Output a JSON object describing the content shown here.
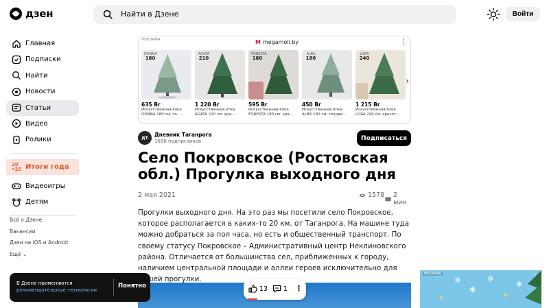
{
  "header": {
    "logo_text": "дзен",
    "search_placeholder": "Найти в Дзене",
    "login_label": "Войти"
  },
  "sidebar": {
    "items": [
      {
        "label": "Главная",
        "icon": "home-icon"
      },
      {
        "label": "Подписки",
        "icon": "subscriptions-icon"
      },
      {
        "label": "Найти",
        "icon": "search-icon"
      },
      {
        "label": "Новости",
        "icon": "news-icon"
      },
      {
        "label": "Статьи",
        "icon": "articles-icon",
        "active": true
      },
      {
        "label": "Видео",
        "icon": "video-icon"
      },
      {
        "label": "Ролики",
        "icon": "shorts-icon"
      }
    ],
    "itogi": {
      "badge_top": "20",
      "badge_bottom": "•25",
      "label": "Итоги года"
    },
    "items2": [
      {
        "label": "Видеоигры",
        "icon": "gamepad-icon"
      },
      {
        "label": "Детям",
        "icon": "kids-icon"
      }
    ],
    "footer": [
      "Всё о Дзене",
      "Вакансии",
      "Дзен на iOS и Android",
      "Ещё"
    ]
  },
  "ad": {
    "label": "РЕКЛАМА",
    "brand": "megamoll.by",
    "brand_mark": "M",
    "items": [
      {
        "tag_name": "DONNA",
        "tag_size": "180",
        "price": "635 Br",
        "line1": "Искусственная ёлка",
        "line2": "DONNA 180 см: со-..."
      },
      {
        "tag_name": "AGATA",
        "tag_size": "210",
        "price": "1 220 Br",
        "line1": "Искусственная ёлка",
        "line2": "AGATA 210 см: кра-..."
      },
      {
        "tag_name": "FORESTA",
        "tag_size": "180",
        "price": "595 Br",
        "line1": "Искусственная ёлка",
        "line2": "FORESTA 180 см: кра..."
      },
      {
        "tag_name": "ALBA",
        "tag_size": "180",
        "price": "450 Br",
        "line1": "Искусственная ёлка",
        "line2": "ALBA 180 см: создай..."
      },
      {
        "tag_name": "LORA",
        "tag_size": "240",
        "price": "1 215 Br",
        "line1": "Искусственная ёлка",
        "line2": "LORA 240 см: красот..."
      }
    ]
  },
  "channel": {
    "avatar_text": "ДТ",
    "name": "Дневник Таганрога",
    "subscribers": "1698 подписчиков",
    "subscribe_label": "Подписаться"
  },
  "article": {
    "title": "Село Покровское (Ростовская обл.) Прогулка выходного дня",
    "date": "2 мая 2021",
    "views": "1578",
    "read_time": "2 мин",
    "body": "Прогулки выходного дня. На это раз мы посетили село Покровское, которое располагается в каких-то 20 км. от Таганрога. На машине туда можно добраться за пол часа, но есть и общественный транспорт. По своему статусу Покровское – Административный центр Неклиновского района. Отличается от большинства сел, приближенных к городу, наличием центральной площади и аллеи героев исключительно для пешей прогулки."
  },
  "cookie": {
    "text": "В Дзене применяются",
    "link": "рекомендательные технологии",
    "button": "Понятно"
  },
  "reactions": {
    "likes": "13",
    "comments": "1"
  },
  "side_ad": {
    "label": "РЕКЛАМА"
  },
  "colors": {
    "accent_orange": "#ef5b2c",
    "active_bg": "#e9eaed",
    "photo_sky": "#1d78c8"
  }
}
